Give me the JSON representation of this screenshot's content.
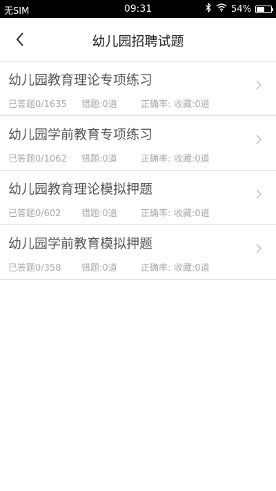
{
  "status_bar": {
    "carrier": "无SIM",
    "time": "09:31",
    "battery": "54%",
    "battery_level": 0.54,
    "icons": [
      "bluetooth-icon",
      "wifi-icon",
      "battery-icon"
    ]
  },
  "header": {
    "title": "幼儿园招聘试题",
    "back_icon": "chevron-left-icon"
  },
  "items": [
    {
      "title": "幼儿园教育理论专项练习",
      "answered": "已答题0/1635",
      "wrong": "错题:0道",
      "accuracy": "正确率:",
      "favorites": "收藏:0道"
    },
    {
      "title": "幼儿园学前教育专项练习",
      "answered": "已答题0/1062",
      "wrong": "错题:0道",
      "accuracy": "正确率:",
      "favorites": "收藏:0道"
    },
    {
      "title": "幼儿园教育理论模拟押题",
      "answered": "已答题0/602",
      "wrong": "错题:0道",
      "accuracy": "正确率:",
      "favorites": "收藏:0道"
    },
    {
      "title": "幼儿园学前教育模拟押题",
      "answered": "已答题0/358",
      "wrong": "错题:0道",
      "accuracy": "正确率:",
      "favorites": "收藏:0道"
    }
  ],
  "colors": {
    "status_bg": "#000000",
    "title_text": "#555555",
    "meta_text": "#a8a8a8",
    "divider": "#dddddd"
  }
}
